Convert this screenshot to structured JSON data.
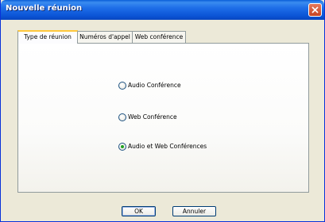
{
  "window": {
    "title": "Nouvelle réunion"
  },
  "tabs": [
    {
      "label": "Type de réunion",
      "active": true
    },
    {
      "label": "Numéros d'appel",
      "active": false
    },
    {
      "label": "Web conférence",
      "active": false
    }
  ],
  "options": [
    {
      "label": "Audio Conférence",
      "selected": false
    },
    {
      "label": "Web Conférence",
      "selected": false
    },
    {
      "label": "Audio et Web Conférences",
      "selected": true
    }
  ],
  "buttons": {
    "ok": "OK",
    "cancel": "Annuler"
  },
  "colors": {
    "titlebar": "#0a5fd8",
    "dialog_bg": "#ece9d8",
    "close_button": "#d8553a",
    "active_tab_accent": "#ffc83c",
    "radio_dot": "#21a121"
  },
  "icons": {
    "close": "close-icon"
  }
}
